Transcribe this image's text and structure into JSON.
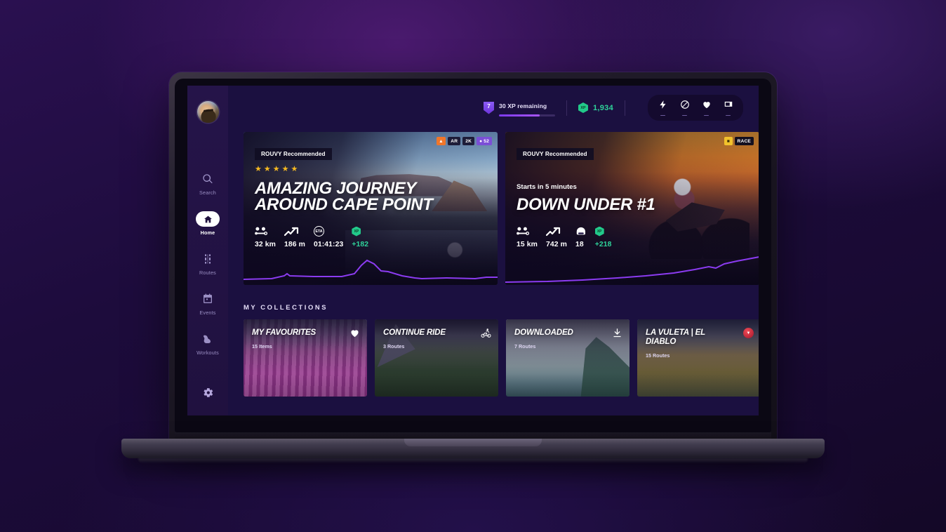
{
  "app": {
    "name": "ROUVY",
    "screen_title": "Home"
  },
  "sidebar": {
    "avatar_name": "user-avatar",
    "items": [
      {
        "label": "Search",
        "icon": "search-icon",
        "active": false
      },
      {
        "label": "Home",
        "icon": "home-icon",
        "active": true
      },
      {
        "label": "Routes",
        "icon": "road-icon",
        "active": false
      },
      {
        "label": "Events",
        "icon": "calendar-icon",
        "active": false
      },
      {
        "label": "Workouts",
        "icon": "muscle-icon",
        "active": false
      }
    ],
    "settings_label": "Settings",
    "settings_icon": "gear-icon"
  },
  "topbar": {
    "level": "7",
    "xp_remaining": "30 XP remaining",
    "xp_progress_percent": 72,
    "coin_icon_label": "XP",
    "coin_value": "1,934",
    "devices": [
      {
        "name": "power-meter",
        "icon": "bolt-icon",
        "connected": false
      },
      {
        "name": "cadence-sensor",
        "icon": "cadence-icon",
        "connected": false
      },
      {
        "name": "heart-rate-monitor",
        "icon": "heart-icon",
        "connected": false
      },
      {
        "name": "smart-trainer",
        "icon": "trainer-icon",
        "connected": false
      }
    ]
  },
  "heroes": [
    {
      "tag": "ROUVY Recommended",
      "stars": 5,
      "title_line1": "AMAZING JOURNEY",
      "title_line2": "AROUND CAPE POINT",
      "subtitle": "",
      "badges": [
        {
          "type": "fire",
          "label": "▲"
        },
        {
          "type": "dark",
          "label": "AR"
        },
        {
          "type": "dark",
          "label": "2K"
        },
        {
          "type": "purple",
          "label": "52"
        }
      ],
      "stats": [
        {
          "icon": "route-distance-icon",
          "value": "32 km"
        },
        {
          "icon": "elevation-icon",
          "value": "186 m"
        },
        {
          "icon": "eta-icon",
          "value": "01:41:23"
        },
        {
          "icon": "xp-icon",
          "value": "+182",
          "accent": true
        }
      ]
    },
    {
      "tag": "ROUVY Recommended",
      "stars": 0,
      "title_line1": "DOWN UNDER #1",
      "title_line2": "",
      "subtitle": "Starts in 5 minutes",
      "badges": [
        {
          "type": "trophy",
          "label": "■"
        },
        {
          "type": "race",
          "label": "RACE"
        }
      ],
      "stats": [
        {
          "icon": "route-distance-icon",
          "value": "15 km"
        },
        {
          "icon": "elevation-icon",
          "value": "742 m"
        },
        {
          "icon": "riders-icon",
          "value": "18"
        },
        {
          "icon": "xp-icon",
          "value": "+218",
          "accent": true
        }
      ]
    }
  ],
  "collections_section": {
    "title": "MY COLLECTIONS",
    "items": [
      {
        "title": "MY FAVOURITES",
        "subtitle": "15 Items",
        "icon": "heart-icon"
      },
      {
        "title": "CONTINUE RIDE",
        "subtitle": "3 Routes",
        "icon": "cyclist-icon"
      },
      {
        "title": "DOWNLOADED",
        "subtitle": "7 Routes",
        "icon": "download-icon"
      },
      {
        "title": "LA VULETA |  EL",
        "title2": "DIABLO",
        "subtitle": "15 Routes",
        "icon": "vuelta-badge-icon"
      }
    ]
  },
  "colors": {
    "accent_purple": "#7c3aed",
    "accent_green": "#2fd39a",
    "app_bg": "#1b1040",
    "sidebar_bg": "#20113f",
    "badge_orange": "#f0762a",
    "badge_yellow": "#f2c22c",
    "star_gold": "#f5b921"
  }
}
